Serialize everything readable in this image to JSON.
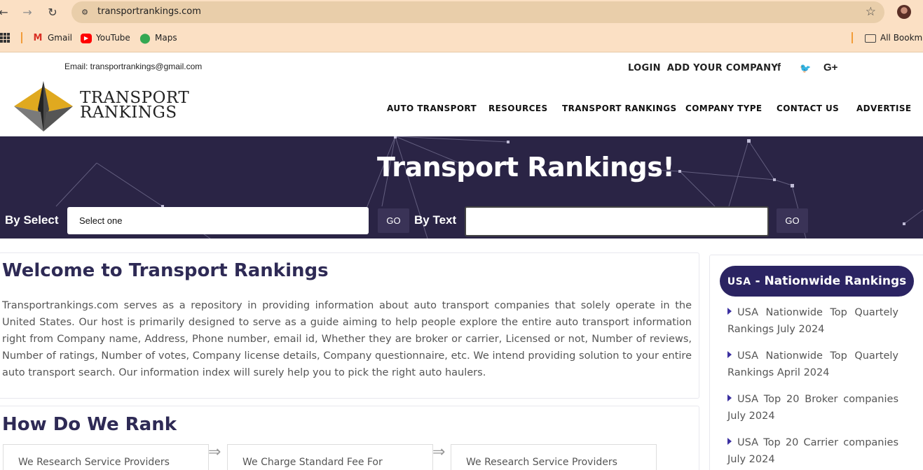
{
  "browser": {
    "url": "transportrankings.com",
    "bookmarks": [
      {
        "label": "Gmail",
        "icon": "gmail-icon"
      },
      {
        "label": "YouTube",
        "icon": "youtube-icon"
      },
      {
        "label": "Maps",
        "icon": "maps-icon"
      }
    ],
    "all_bookmarks": "All Bookma"
  },
  "header": {
    "email": "Email: transportrankings@gmail.com",
    "login": "LOGIN",
    "add_company": "ADD YOUR COMPANY",
    "social": {
      "facebook": "f",
      "twitter": "🐦",
      "google": "G+"
    },
    "logo_line1": "TRANSPORT",
    "logo_line2": "RANKINGS",
    "nav": [
      "AUTO TRANSPORT",
      "RESOURCES",
      "TRANSPORT RANKINGS",
      "COMPANY TYPE",
      "CONTACT US",
      "ADVERTISE"
    ]
  },
  "hero": {
    "title": "Transport Rankings!",
    "by_select": "By Select",
    "select_value": "Select one",
    "go": "GO",
    "by_text": "By Text",
    "text_value": ""
  },
  "welcome": {
    "title": "Welcome to Transport Rankings",
    "body": "Transportrankings.com serves as a repository in providing information about auto transport companies that solely operate in the United States. Our host is primarily designed to serve as a guide aiming to help people explore the entire auto transport information right from Company name, Address, Phone number, email id, Whether they are broker or carrier, Licensed or not, Number of reviews, Number of ratings, Number of votes, Company license details, Company questionnaire, etc. We intend providing solution to your entire auto transport search. Our information index will surely help you to pick the right auto haulers."
  },
  "rank": {
    "title": "How Do We Rank",
    "steps": [
      "We Research Service Providers",
      "We Charge Standard Fee For",
      "We Research Service Providers"
    ],
    "arrow": "⇒"
  },
  "sidebar": {
    "pill_prefix": "USA",
    "pill_rest": " - Nationwide Rankings",
    "items": [
      "USA Nationwide Top Quartely Rankings July 2024",
      "USA Nationwide Top Quartely Rankings April 2024",
      "USA Top 20 Broker companies July 2024",
      "USA Top 20 Carrier companies July 2024"
    ]
  }
}
